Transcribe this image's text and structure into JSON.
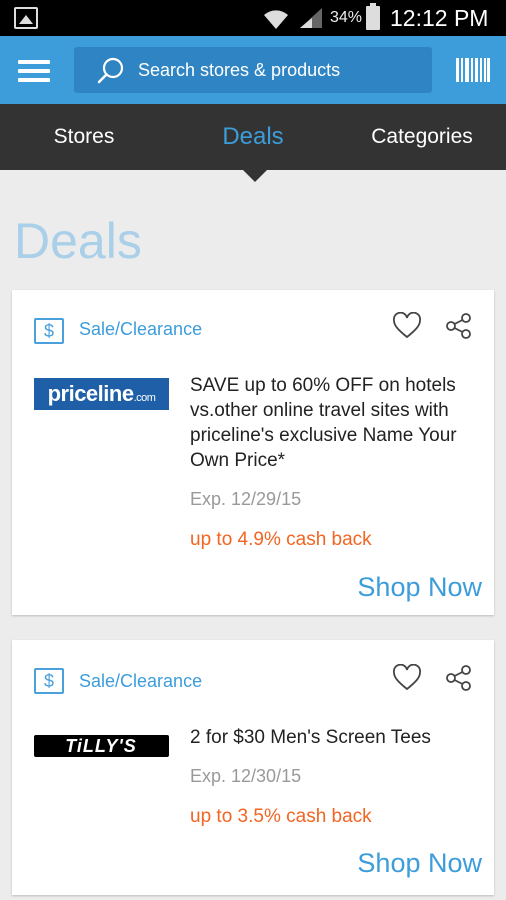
{
  "status_bar": {
    "battery_percent": "34%",
    "time": "12:12 PM"
  },
  "app_bar": {
    "search_placeholder": "Search stores & products"
  },
  "tabs": [
    {
      "label": "Stores",
      "active": false
    },
    {
      "label": "Deals",
      "active": true
    },
    {
      "label": "Categories",
      "active": false
    }
  ],
  "page_title": "Deals",
  "deals": [
    {
      "tag_label": "Sale/Clearance",
      "tag_symbol": "$",
      "store_logo": "priceline.com",
      "description": "SAVE up to 60% OFF on hotels vs.other online travel sites with priceline's exclusive Name Your Own Price*",
      "expiration": "Exp. 12/29/15",
      "cash_back": "up to 4.9% cash back",
      "shop_label": "Shop Now"
    },
    {
      "tag_label": "Sale/Clearance",
      "tag_symbol": "$",
      "store_logo": "TiLLY'S",
      "description": "2 for $30 Men's Screen Tees",
      "expiration": "Exp. 12/30/15",
      "cash_back": "up to 3.5% cash back",
      "shop_label": "Shop Now"
    }
  ],
  "colors": {
    "accent": "#3d9ddb",
    "cash_back": "#f26522",
    "tabs_bg": "#333333"
  }
}
